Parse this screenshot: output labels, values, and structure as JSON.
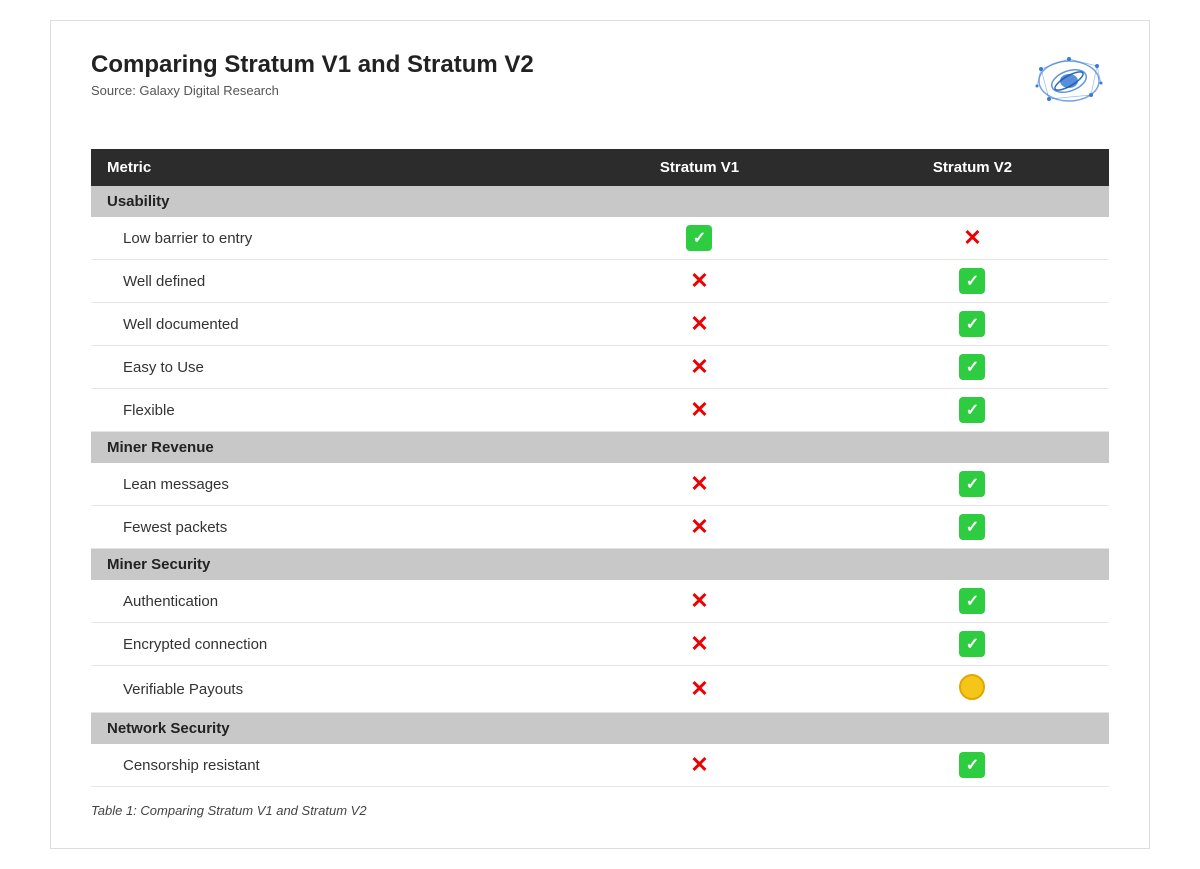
{
  "header": {
    "title": "Comparing Stratum V1 and Stratum V2",
    "source": "Source: Galaxy Digital Research"
  },
  "columns": {
    "metric": "Metric",
    "v1": "Stratum V1",
    "v2": "Stratum V2"
  },
  "categories": [
    {
      "name": "Usability",
      "rows": [
        {
          "label": "Low barrier to entry",
          "v1": "check",
          "v2": "cross"
        },
        {
          "label": "Well defined",
          "v1": "cross",
          "v2": "check"
        },
        {
          "label": "Well documented",
          "v1": "cross",
          "v2": "check"
        },
        {
          "label": "Easy to Use",
          "v1": "cross",
          "v2": "check"
        },
        {
          "label": "Flexible",
          "v1": "cross",
          "v2": "check"
        }
      ]
    },
    {
      "name": "Miner Revenue",
      "rows": [
        {
          "label": "Lean messages",
          "v1": "cross",
          "v2": "check"
        },
        {
          "label": "Fewest packets",
          "v1": "cross",
          "v2": "check"
        }
      ]
    },
    {
      "name": "Miner Security",
      "rows": [
        {
          "label": "Authentication",
          "v1": "cross",
          "v2": "check"
        },
        {
          "label": "Encrypted connection",
          "v1": "cross",
          "v2": "check"
        },
        {
          "label": "Verifiable Payouts",
          "v1": "cross",
          "v2": "circle"
        }
      ]
    },
    {
      "name": "Network Security",
      "rows": [
        {
          "label": "Censorship resistant",
          "v1": "cross",
          "v2": "check"
        }
      ]
    }
  ],
  "footer": "Table 1: Comparing Stratum V1 and Stratum V2"
}
